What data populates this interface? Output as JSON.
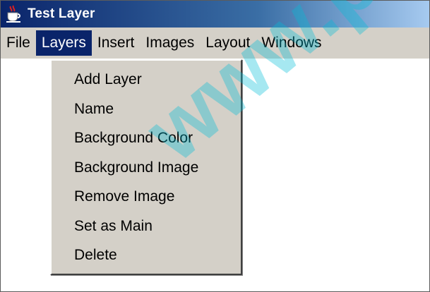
{
  "window": {
    "title": "Test Layer",
    "icon": "java-coffee-cup-icon"
  },
  "menubar": {
    "items": [
      {
        "label": "File"
      },
      {
        "label": "Layers"
      },
      {
        "label": "Insert"
      },
      {
        "label": "Images"
      },
      {
        "label": "Layout"
      },
      {
        "label": "Windows"
      }
    ],
    "active": "Layers"
  },
  "layers_menu": {
    "items": [
      {
        "label": "Add Layer"
      },
      {
        "label": "Name"
      },
      {
        "label": "Background Color"
      },
      {
        "label": "Background Image"
      },
      {
        "label": "Remove Image"
      },
      {
        "label": "Set as Main"
      },
      {
        "label": "Delete"
      }
    ]
  },
  "watermark": "www.pl",
  "colors": {
    "titlebar": "#0a246a",
    "menubar": "#d4d0c8",
    "active_menu": "#0a246a",
    "watermark": "#00bed7"
  }
}
